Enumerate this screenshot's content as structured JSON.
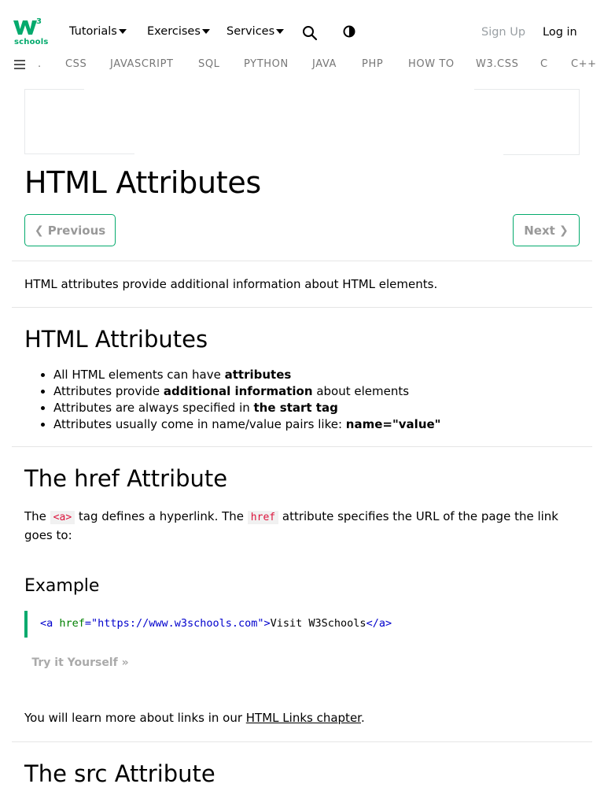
{
  "header": {
    "logo_superscript": "3",
    "logo_text": "schools",
    "menu": [
      {
        "label": "Tutorials"
      },
      {
        "label": "Exercises"
      },
      {
        "label": "Services"
      }
    ],
    "search_icon": "search-icon",
    "contrast_icon": "contrast-icon",
    "signup_label": "Sign Up",
    "login_label": "Log in",
    "brand_color": "#04AA6D"
  },
  "subnav": {
    "menu_icon": "hamburger-icon",
    "items": [
      ".",
      "CSS",
      "JAVASCRIPT",
      "SQL",
      "PYTHON",
      "JAVA",
      "PHP",
      "HOW TO",
      "W3.CSS",
      "C",
      "C++"
    ]
  },
  "page": {
    "title": "HTML Attributes",
    "prev_label": "Previous",
    "next_label": "Next",
    "intro": "HTML attributes provide additional information about HTML elements."
  },
  "section1": {
    "heading": "HTML Attributes",
    "bullets": [
      {
        "text": "All HTML elements can have ",
        "bold": "attributes",
        "after": ""
      },
      {
        "text": "Attributes provide ",
        "bold": "additional information",
        "after": " about elements"
      },
      {
        "text": "Attributes are always specified in ",
        "bold": "the start tag",
        "after": ""
      },
      {
        "text": "Attributes usually come in name/value pairs like: ",
        "bold": "name=\"value\"",
        "after": ""
      }
    ]
  },
  "section2": {
    "heading": "The href Attribute",
    "para_before": "The ",
    "code1": "<a>",
    "para_mid": " tag defines a hyperlink. The ",
    "code2": "href",
    "para_after": " attribute specifies the URL of the page the link goes to:",
    "example_title": "Example",
    "code_tag_open": "<a",
    "code_attr": " href",
    "code_eq": "=",
    "code_val": "\"https://www.w3schools.com\"",
    "code_close_bracket": ">",
    "code_text": "Visit W3Schools",
    "code_tag_close": "</a>",
    "try_label": "Try it Yourself »",
    "links_before": "You will learn more about links in our ",
    "links_link": "HTML Links chapter",
    "links_after": "."
  },
  "section3": {
    "heading": "The src Attribute"
  }
}
